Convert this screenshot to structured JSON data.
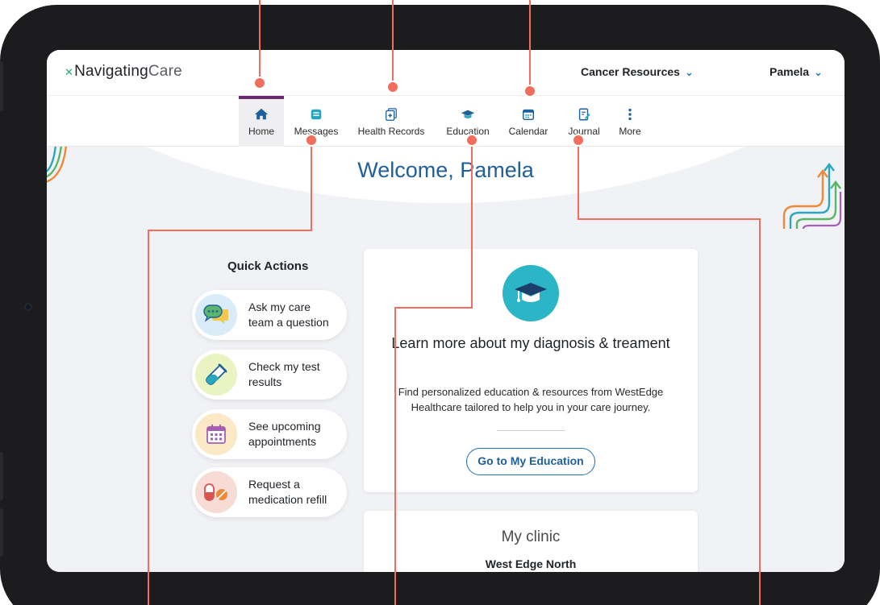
{
  "brand": {
    "logo_main": "Navigating",
    "logo_accent": "Care"
  },
  "topbar": {
    "resources_label": "Cancer Resources",
    "user_label": "Pamela"
  },
  "nav": {
    "items": [
      {
        "label": "Home",
        "icon": "home-icon"
      },
      {
        "label": "Messages",
        "icon": "messages-icon"
      },
      {
        "label": "Health Records",
        "icon": "health-records-icon"
      },
      {
        "label": "Education",
        "icon": "graduation-cap-icon"
      },
      {
        "label": "Calendar",
        "icon": "calendar-icon"
      },
      {
        "label": "Journal",
        "icon": "journal-icon"
      },
      {
        "label": "More",
        "icon": "more-vertical-icon"
      }
    ],
    "active": "Home"
  },
  "welcome": "Welcome, Pamela",
  "quick_actions": {
    "title": "Quick Actions",
    "items": [
      {
        "label": "Ask my care team a question",
        "icon": "chat-bubbles-icon"
      },
      {
        "label": "Check my test results",
        "icon": "test-tube-icon"
      },
      {
        "label": "See upcoming appointments",
        "icon": "calendar-icon"
      },
      {
        "label": "Request a medication refill",
        "icon": "pills-icon"
      }
    ]
  },
  "education_card": {
    "title": "Learn more about my diagnosis & treament",
    "description": "Find personalized education & resources from WestEdge Healthcare tailored to help you in your care journey.",
    "cta": "Go to My Education"
  },
  "clinic_card": {
    "title": "My clinic",
    "name": "West Edge North"
  },
  "colors": {
    "accent": "#1f6fb5",
    "active_tab": "#6b2c6f",
    "annotation": "#f26d5b",
    "education_badge": "#2cb4c7"
  }
}
